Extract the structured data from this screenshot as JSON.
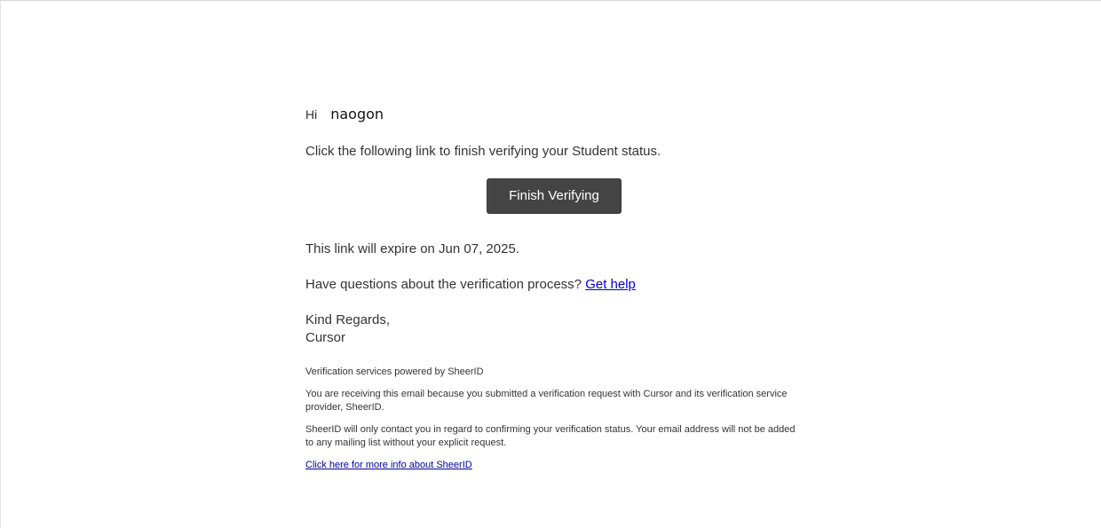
{
  "email": {
    "greeting": "Hi",
    "recipient_name": "naogon",
    "intro": "Click the following link to finish verifying your Student status.",
    "button_label": "Finish Verifying",
    "expiry_text": "This link will expire on Jun 07, 2025.",
    "questions_text": "Have questions about the verification process?",
    "help_link": "Get help",
    "sign_off": "Kind Regards,",
    "sender": "Cursor",
    "footer": {
      "powered_by": "Verification services powered by SheerID",
      "reason": "You are receiving this email because you submitted a verification request with Cursor and its verification service provider, SheerID.",
      "privacy": "SheerID will only contact you in regard to confirming your verification status. Your email address will not be added to any mailing list without your explicit request.",
      "info_link": "Click here for more info about SheerID"
    }
  },
  "colors": {
    "button_bg": "#444444",
    "link": "#0000cc",
    "text": "#333333"
  }
}
